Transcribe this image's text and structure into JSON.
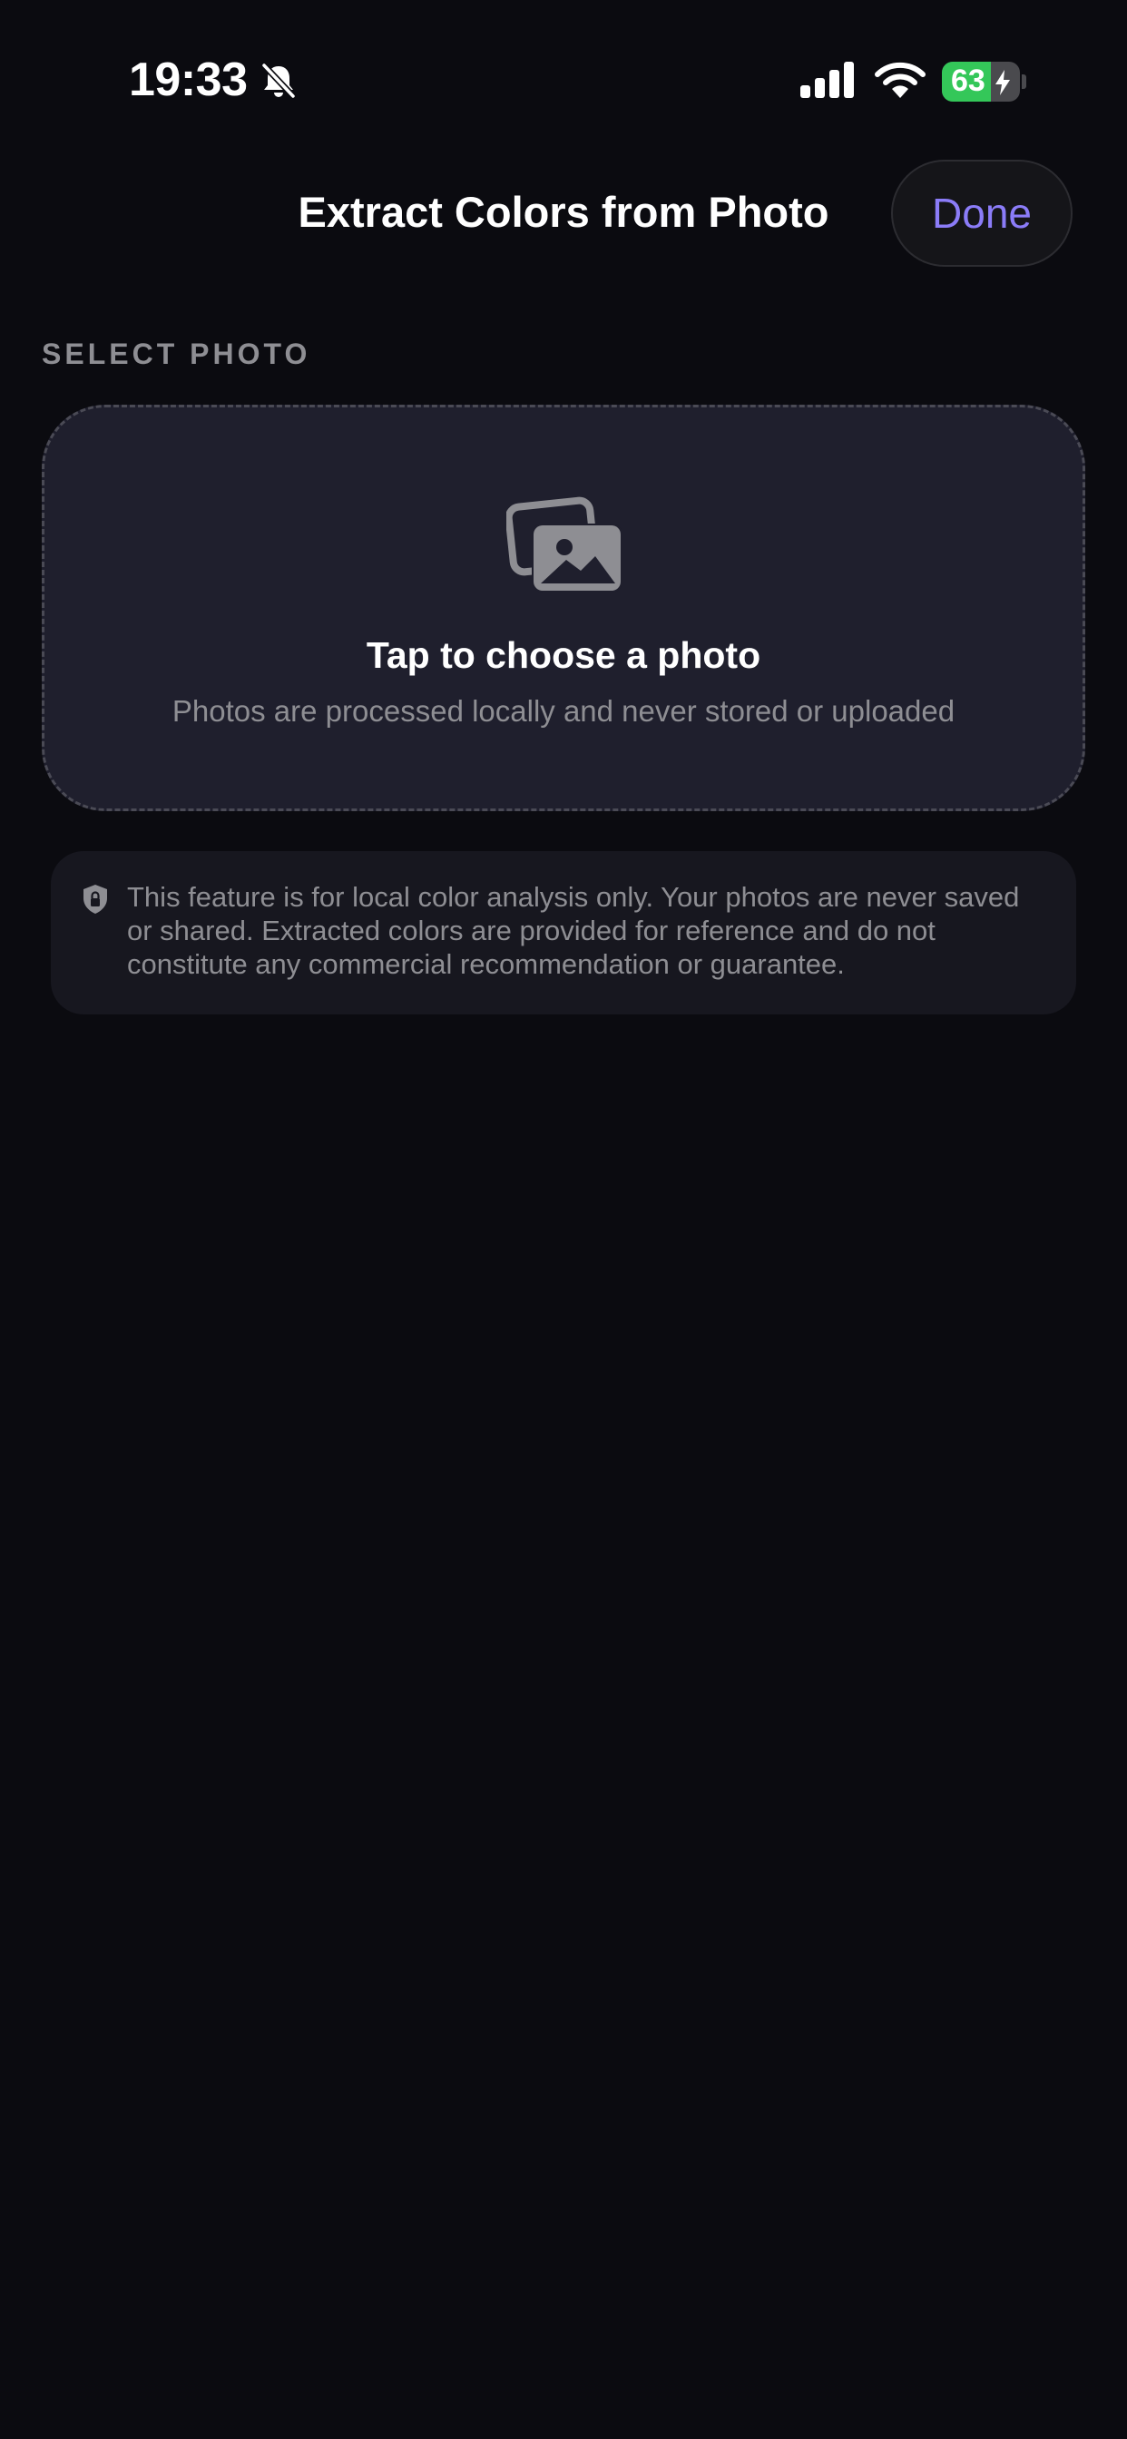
{
  "status_bar": {
    "time": "19:33",
    "battery_percent": "63",
    "battery_level": 0.63,
    "battery_charging": true,
    "silent_mode_icon": "bell-slash-icon",
    "signal_icon": "cellular-signal-icon",
    "wifi_icon": "wifi-icon"
  },
  "nav": {
    "title": "Extract Colors from Photo",
    "done_label": "Done"
  },
  "section": {
    "label": "SELECT PHOTO"
  },
  "picker": {
    "icon": "photos-icon",
    "title": "Tap to choose a photo",
    "subtitle": "Photos are processed locally and never stored or uploaded"
  },
  "notice": {
    "icon": "shield-lock-icon",
    "text": "This feature is for local color analysis only. Your photos are never saved or shared. Extracted colors are provided for reference and do not constitute any commercial recommendation or guarantee."
  },
  "colors": {
    "background": "#0b0b10",
    "accent": "#8b7cf8",
    "card": "#1f1f2d",
    "battery_green": "#34c759"
  }
}
